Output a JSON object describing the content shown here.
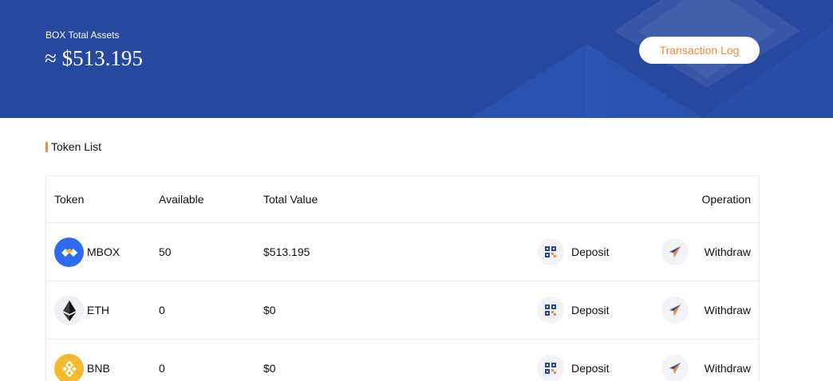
{
  "header": {
    "assets_label": "BOX Total Assets",
    "assets_value": "≈ $513.195",
    "transaction_log_label": "Transaction Log"
  },
  "section": {
    "title": "Token List"
  },
  "table": {
    "columns": {
      "token": "Token",
      "available": "Available",
      "total_value": "Total Value",
      "operation": "Operation"
    },
    "rows": [
      {
        "token": "MBOX",
        "icon": "mbox-icon",
        "available": "50",
        "total_value": "$513.195",
        "deposit": "Deposit",
        "withdraw": "Withdraw"
      },
      {
        "token": "ETH",
        "icon": "eth-icon",
        "available": "0",
        "total_value": "$0",
        "deposit": "Deposit",
        "withdraw": "Withdraw"
      },
      {
        "token": "BNB",
        "icon": "bnb-icon",
        "available": "0",
        "total_value": "$0",
        "deposit": "Deposit",
        "withdraw": "Withdraw"
      }
    ]
  },
  "colors": {
    "banner": "#26489f",
    "accent": "#f08a3a",
    "mbox": "#2f6bf0",
    "bnb": "#f3ba2f"
  }
}
